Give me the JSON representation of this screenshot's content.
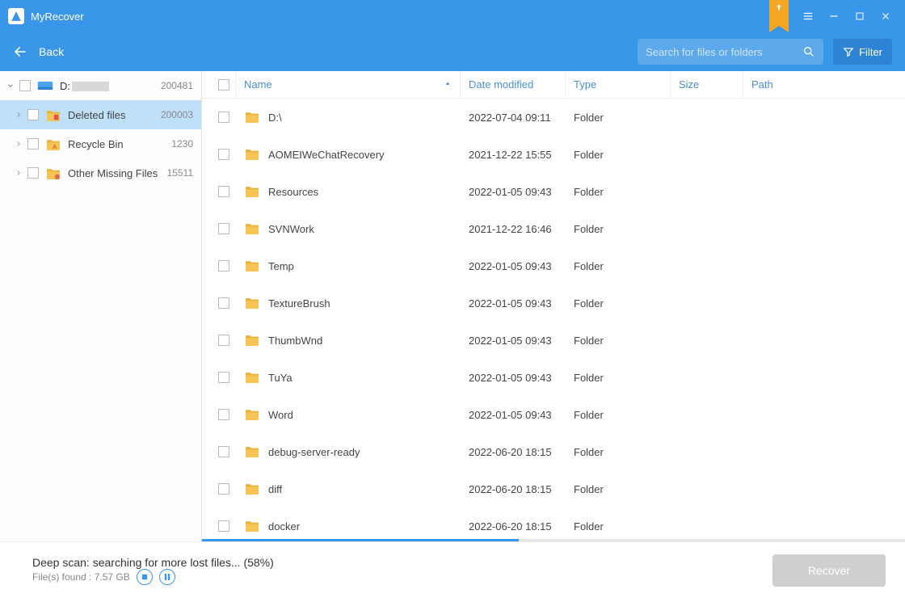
{
  "app": {
    "title": "MyRecover"
  },
  "toolbar": {
    "back_label": "Back",
    "search_placeholder": "Search for files or folders",
    "filter_label": "Filter"
  },
  "sidebar": {
    "drive": {
      "label": "D:",
      "count": "200481"
    },
    "items": [
      {
        "label": "Deleted files",
        "count": "200003",
        "selected": true,
        "icon": "folder-deleted"
      },
      {
        "label": "Recycle Bin",
        "count": "1230",
        "selected": false,
        "icon": "folder-recycle"
      },
      {
        "label": "Other Missing Files",
        "count": "15511",
        "selected": false,
        "icon": "folder-missing"
      }
    ]
  },
  "columns": {
    "name": "Name",
    "date": "Date modified",
    "type": "Type",
    "size": "Size",
    "path": "Path"
  },
  "rows": [
    {
      "name": "D:\\",
      "date": "2022-07-04 09:11",
      "type": "Folder"
    },
    {
      "name": "AOMEIWeChatRecovery",
      "date": "2021-12-22 15:55",
      "type": "Folder"
    },
    {
      "name": "Resources",
      "date": "2022-01-05 09:43",
      "type": "Folder"
    },
    {
      "name": "SVNWork",
      "date": "2021-12-22 16:46",
      "type": "Folder"
    },
    {
      "name": "Temp",
      "date": "2022-01-05 09:43",
      "type": "Folder"
    },
    {
      "name": "TextureBrush",
      "date": "2022-01-05 09:43",
      "type": "Folder"
    },
    {
      "name": "ThumbWnd",
      "date": "2022-01-05 09:43",
      "type": "Folder"
    },
    {
      "name": "TuYa",
      "date": "2022-01-05 09:43",
      "type": "Folder"
    },
    {
      "name": "Word",
      "date": "2022-01-05 09:43",
      "type": "Folder"
    },
    {
      "name": "debug-server-ready",
      "date": "2022-06-20 18:15",
      "type": "Folder"
    },
    {
      "name": "diff",
      "date": "2022-06-20 18:15",
      "type": "Folder"
    },
    {
      "name": "docker",
      "date": "2022-06-20 18:15",
      "type": "Folder"
    }
  ],
  "progress": {
    "percent": 45
  },
  "footer": {
    "status_line": "Deep scan: searching for more lost files... (58%)",
    "found_line": "File(s) found : 7.57 GB",
    "recover_label": "Recover"
  }
}
